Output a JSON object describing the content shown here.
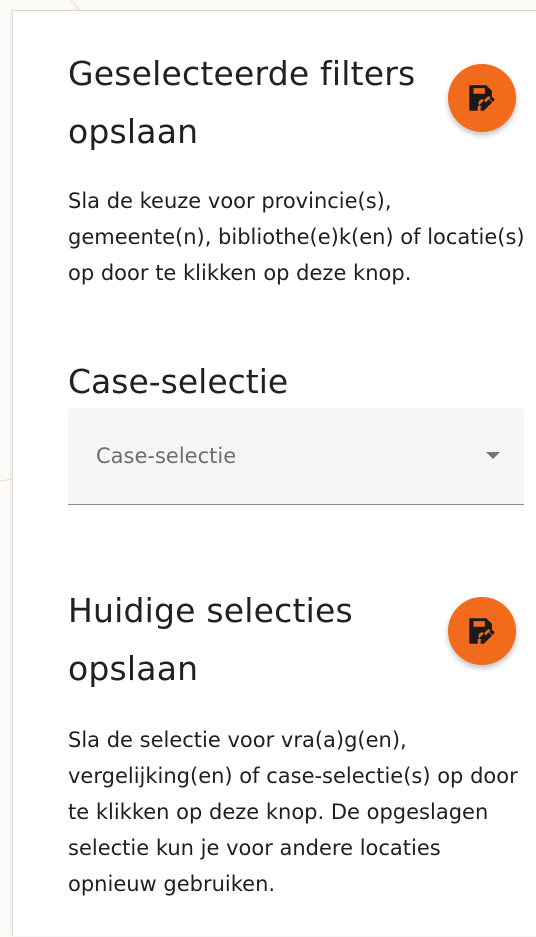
{
  "colors": {
    "accent": "#f26a1b",
    "text": "#212121"
  },
  "filters_section": {
    "title": "Geselecteerde filters opslaan",
    "save_icon": "save-edit-icon",
    "description": "Sla de keuze voor provincie(s), gemeente(n), bibliothe(e)k(en) of locatie(s) op door te klikken op deze knop."
  },
  "case_selection": {
    "title": "Case-selectie",
    "placeholder": "Case-selectie",
    "arrow_icon": "dropdown-arrow-icon"
  },
  "selections_section": {
    "title": "Huidige selecties opslaan",
    "save_icon": "save-edit-icon",
    "description": "Sla de selectie voor vra(a)g(en), vergelijking(en) of case-selectie(s) op door te klikken op deze knop. De opgeslagen selectie kun je voor andere locaties opnieuw gebruiken."
  }
}
